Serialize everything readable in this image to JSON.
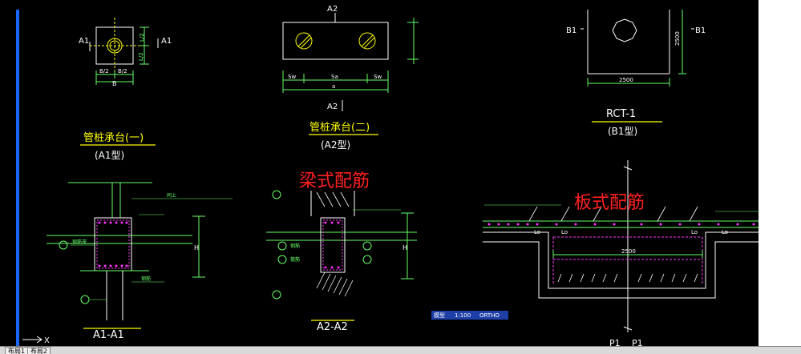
{
  "canvas": {
    "bg": "#000000",
    "accent": "#1a66ff"
  },
  "top_labels": {
    "a2_top": "A2",
    "a1_left": "A1",
    "a1_right": "A1",
    "b1_left": "B1",
    "b1_right": "B1"
  },
  "dims": {
    "b2_left": "B/2",
    "b2_right": "B/2",
    "b": "B",
    "l2_top": "L/2",
    "l2_bot": "L/2",
    "sw_left": "Sw",
    "sa": "Sa",
    "sw_right": "Sw",
    "a_bottom": "a",
    "a2_bottom": "A2",
    "b1_2500": "2500",
    "b1_side": "2500"
  },
  "titles": {
    "a1_title": "管桩承台(一)",
    "a1_sub": "(A1型)",
    "a2_title": "管桩承台(二)",
    "a2_sub": "(A2型)",
    "rct_title": "RCT-1",
    "rct_sub": "(B1型)"
  },
  "red_labels": {
    "beam": "梁式配筋",
    "slab": "板式配筋"
  },
  "sections": {
    "a1": "A1-A1",
    "a2": "A2-A2",
    "p1a": "P1",
    "p1b": "P1"
  },
  "callouts": {
    "c1": "同上",
    "c2": "钢筋笼",
    "c3": "钢筋",
    "c4": "箍筋",
    "lo1": "Lo",
    "lo2": "Lo",
    "lo3": "Lo",
    "lo4": "Lo",
    "sl_2500": "2500",
    "h1": "H",
    "h2": "H"
  },
  "status": {
    "s1": "模型",
    "s2": "1:100",
    "s3": "ORTHO"
  },
  "tabs": [
    "布局1",
    "布局2"
  ],
  "ucs": "X"
}
